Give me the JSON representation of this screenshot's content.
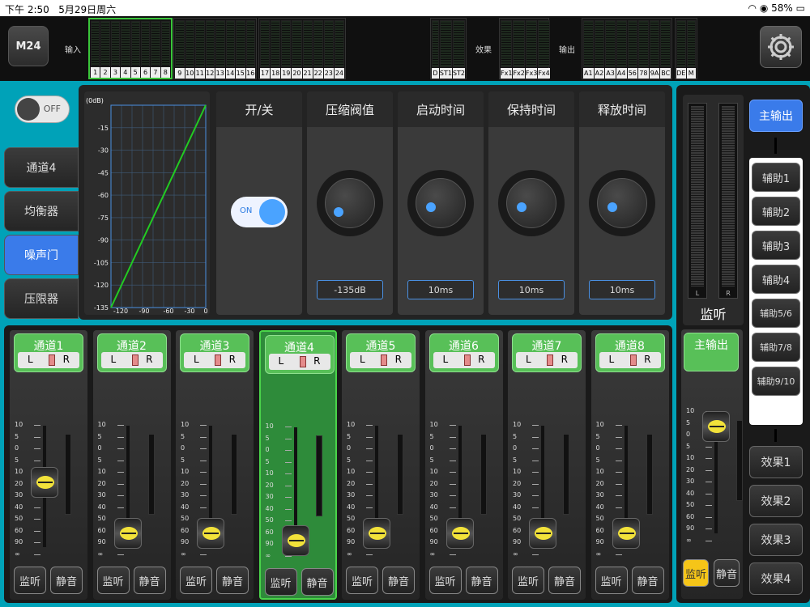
{
  "status": {
    "time": "下午 2:50",
    "date": "5月29日周六",
    "battery": "58%"
  },
  "app": {
    "logo": "M24"
  },
  "meters": {
    "input_label": "输入",
    "fx_label": "效果",
    "out_label": "输出",
    "group1": [
      "1",
      "2",
      "3",
      "4",
      "5",
      "6",
      "7",
      "8"
    ],
    "group2": [
      "9",
      "10",
      "11",
      "12",
      "13",
      "14",
      "15",
      "16"
    ],
    "group3": [
      "17",
      "18",
      "19",
      "20",
      "21",
      "22",
      "23",
      "24"
    ],
    "group4": [
      "D",
      "ST1",
      "ST2"
    ],
    "group5": [
      "Fx1",
      "Fx2",
      "Fx3",
      "Fx4"
    ],
    "group6": [
      "A1",
      "A2",
      "A3",
      "A4",
      "56",
      "78",
      "9A",
      "BC"
    ],
    "group7": [
      "DE",
      "M"
    ]
  },
  "power_toggle": {
    "label": "OFF"
  },
  "side_tabs": [
    "通道4",
    "均衡器",
    "噪声门",
    "压限器"
  ],
  "gate": {
    "graph_top": "(0dB)",
    "graph_y": [
      "-15",
      "-30",
      "-45",
      "-60",
      "-75",
      "-90",
      "-105",
      "-120",
      "-135"
    ],
    "graph_x": [
      "-120",
      "-90",
      "-60",
      "-30",
      "0"
    ],
    "onoff_header": "开/关",
    "onoff_state": "ON",
    "controls": [
      {
        "header": "压缩阀值",
        "value": "-135dB"
      },
      {
        "header": "启动时间",
        "value": "10ms"
      },
      {
        "header": "保持时间",
        "value": "10ms"
      },
      {
        "header": "释放时间",
        "value": "10ms"
      }
    ]
  },
  "monitor": {
    "label": "监听",
    "left": "L",
    "right": "R"
  },
  "outputs": [
    "主输出",
    "辅助1",
    "辅助2",
    "辅助3",
    "辅助4",
    "辅助5/6",
    "辅助7/8",
    "辅助9/10"
  ],
  "effects": [
    "效果1",
    "效果2",
    "效果3",
    "效果4"
  ],
  "fader_scale": [
    "10",
    "5",
    "0",
    "5",
    "10",
    "20",
    "30",
    "40",
    "50",
    "60",
    "90",
    "∞"
  ],
  "channels": [
    {
      "name": "通道1",
      "level": 0.55
    },
    {
      "name": "通道2",
      "level": 0.1
    },
    {
      "name": "通道3",
      "level": 0.1
    },
    {
      "name": "通道4",
      "level": 0.05
    },
    {
      "name": "通道5",
      "level": 0.1
    },
    {
      "name": "通道6",
      "level": 0.1
    },
    {
      "name": "通道7",
      "level": 0.1
    },
    {
      "name": "通道8",
      "level": 0.1
    }
  ],
  "master": {
    "name": "主输出",
    "level": 0.92
  },
  "lr": {
    "l": "L",
    "r": "R"
  },
  "buttons": {
    "listen": "监听",
    "mute": "静音"
  }
}
